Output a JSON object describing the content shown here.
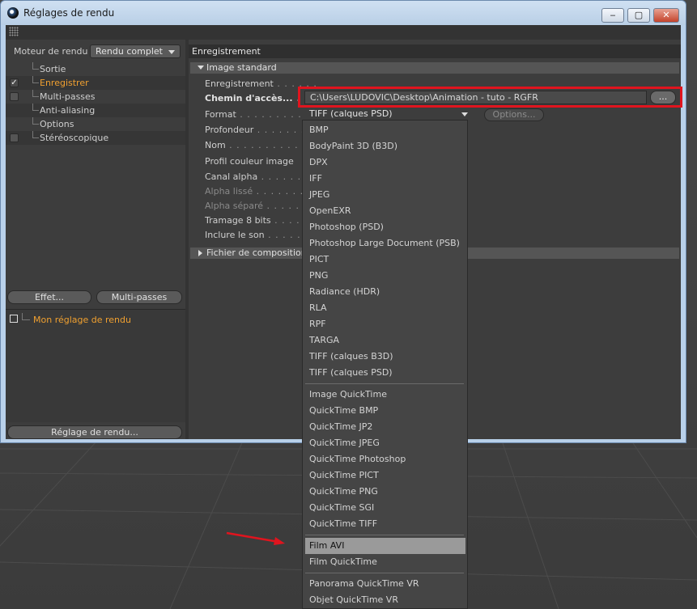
{
  "window": {
    "title": "Réglages de rendu",
    "minimize": "‒",
    "maximize": "▢",
    "close": "✕"
  },
  "left": {
    "renderer_label": "Moteur de rendu",
    "renderer_value": "Rendu complet",
    "tree": [
      {
        "label": "Sortie",
        "checkbox": false,
        "checked": false,
        "active": false
      },
      {
        "label": "Enregistrer",
        "checkbox": true,
        "checked": true,
        "active": true
      },
      {
        "label": "Multi-passes",
        "checkbox": true,
        "checked": false,
        "active": false
      },
      {
        "label": "Anti-aliasing",
        "checkbox": false,
        "checked": false,
        "active": false
      },
      {
        "label": "Options",
        "checkbox": false,
        "checked": false,
        "active": false
      },
      {
        "label": "Stéréoscopique",
        "checkbox": true,
        "checked": false,
        "active": false
      }
    ],
    "effect_button": "Effet...",
    "multipass_button": "Multi-passes",
    "preset": "Mon réglage de rendu",
    "render_setting_button": "Réglage de rendu..."
  },
  "right": {
    "section": "Enregistrement",
    "group_image": "Image standard",
    "props": {
      "save": "Enregistrement",
      "path": "Chemin d'accès...",
      "format": "Format",
      "depth": "Profondeur",
      "name": "Nom",
      "color_profile": "Profil couleur image",
      "alpha_channel": "Canal alpha",
      "alpha_smooth": "Alpha lissé",
      "alpha_separate": "Alpha séparé",
      "dither": "Tramage 8 bits",
      "include_sound": "Inclure le son"
    },
    "save_check": "✓",
    "path_value": "C:\\Users\\LUDOVIC\\Desktop\\Animation - tuto - RGFR",
    "path_button": "...",
    "format_value": "TIFF (calques PSD)",
    "options_button": "Options...",
    "group_comp": "Fichier de composition"
  },
  "dropdown": {
    "group1": [
      "BMP",
      "BodyPaint 3D (B3D)",
      "DPX",
      "IFF",
      "JPEG",
      "OpenEXR",
      "Photoshop (PSD)",
      "Photoshop Large Document (PSB)",
      "PICT",
      "PNG",
      "Radiance (HDR)",
      "RLA",
      "RPF",
      "TARGA",
      "TIFF (calques B3D)",
      "TIFF (calques PSD)"
    ],
    "group2": [
      "Image QuickTime",
      "QuickTime BMP",
      "QuickTime JP2",
      "QuickTime JPEG",
      "QuickTime Photoshop",
      "QuickTime PICT",
      "QuickTime PNG",
      "QuickTime SGI",
      "QuickTime TIFF"
    ],
    "group3": [
      "Film AVI",
      "Film QuickTime"
    ],
    "group4": [
      "Panorama QuickTime VR",
      "Objet QuickTime VR"
    ],
    "selected": "Film AVI"
  },
  "colors": {
    "accent_orange": "#f0a030",
    "highlight_red": "#e0141e"
  }
}
